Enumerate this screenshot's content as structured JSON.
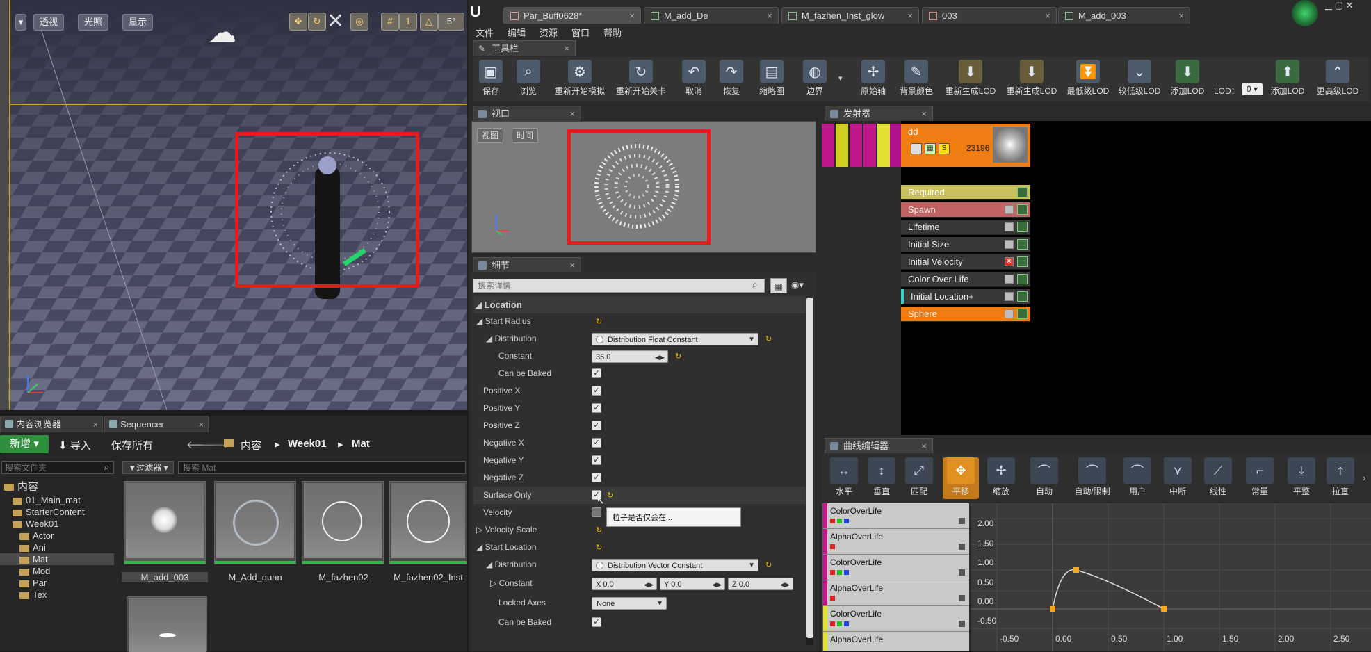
{
  "left_viewport": {
    "buttons": [
      "透视",
      "光照",
      "显示"
    ],
    "grid_snap": "5°"
  },
  "content_browser": {
    "tabs": [
      "内容浏览器",
      "Sequencer"
    ],
    "new_button": "新增",
    "import_button": "导入",
    "save_all_button": "保存所有",
    "breadcrumb": [
      "内容",
      "Week01",
      "Mat"
    ],
    "folder_search_placeholder": "搜索文件夹",
    "filter_button": "过滤器",
    "asset_search_placeholder": "搜索 Mat",
    "folders": [
      "内容",
      "01_Main_mat",
      "StarterContent",
      "Week01",
      "Actor",
      "Ani",
      "Mat",
      "Mod",
      "Par",
      "Tex"
    ],
    "assets": [
      "M_add_003",
      "M_Add_quan",
      "M_fazhen02",
      "M_fazhen02_Inst"
    ]
  },
  "editor": {
    "doc_tabs": [
      "Par_Buff0628*",
      "M_add_De",
      "M_fazhen_Inst_glow",
      "003",
      "M_add_003"
    ],
    "menu": [
      "文件",
      "编辑",
      "资源",
      "窗口",
      "帮助"
    ],
    "toolbar_tab": "工具栏",
    "toolbar": [
      {
        "label": "保存",
        "icon": "save-icon"
      },
      {
        "label": "浏览",
        "icon": "browse-icon"
      },
      {
        "label": "重新开始模拟",
        "icon": "restart-sim-icon"
      },
      {
        "label": "重新开始关卡",
        "icon": "restart-level-icon"
      },
      {
        "label": "取消",
        "icon": "undo-icon"
      },
      {
        "label": "恢复",
        "icon": "redo-icon"
      },
      {
        "label": "缩略图",
        "icon": "thumbnail-icon"
      },
      {
        "label": "边界",
        "icon": "bounds-icon"
      },
      {
        "label": "原始轴",
        "icon": "origin-axis-icon"
      },
      {
        "label": "背景颜色",
        "icon": "bg-color-icon"
      },
      {
        "label": "重新生成LOD",
        "icon": "regen-lod-icon"
      },
      {
        "label": "重新生成LOD",
        "icon": "regen-lod-icon"
      },
      {
        "label": "最低级LOD",
        "icon": "lowest-lod-icon"
      },
      {
        "label": "较低级LOD",
        "icon": "lower-lod-icon"
      },
      {
        "label": "添加LOD",
        "icon": "add-lod-icon"
      },
      {
        "label": "添加LOD",
        "icon": "add-lod-icon"
      },
      {
        "label": "更高级LOD",
        "icon": "higher-lod-icon"
      }
    ],
    "lod_label": "LOD：",
    "lod_value": "0",
    "viewport_tab": "视口",
    "viewport_buttons": [
      "视图",
      "时间"
    ],
    "details_tab": "细节",
    "details_search_placeholder": "搜索详情",
    "emitter_tab": "发射器",
    "emitter": {
      "name": "dd",
      "count": "23196",
      "s_label": "S"
    },
    "modules": [
      "Required",
      "Spawn",
      "Lifetime",
      "Initial Size",
      "Initial Velocity",
      "Color Over Life",
      "Initial Location+",
      "Sphere"
    ],
    "curve_editor_tab": "曲线编辑器",
    "curve_tools": [
      "水平",
      "垂直",
      "匹配",
      "平移",
      "缩放",
      "自动",
      "自动/限制",
      "用户",
      "中断",
      "线性",
      "常量",
      "平整",
      "拉直"
    ],
    "curve_items": [
      "ColorOverLife",
      "AlphaOverLife",
      "ColorOverLife",
      "AlphaOverLife",
      "ColorOverLife",
      "AlphaOverLife"
    ],
    "y_ticks": [
      "2.00",
      "1.50",
      "1.00",
      "0.50",
      "0.00",
      "-0.50"
    ],
    "x_ticks": [
      "-0.50",
      "0.00",
      "0.50",
      "1.00",
      "1.50",
      "2.00",
      "2.50"
    ]
  },
  "details": {
    "section": "Location",
    "start_radius": "Start Radius",
    "distribution": "Distribution",
    "dist_float_value": "Distribution Float Constant",
    "constant": "Constant",
    "constant_value": "35.0",
    "can_be_baked": "Can be Baked",
    "positive_x": "Positive X",
    "positive_y": "Positive Y",
    "positive_z": "Positive Z",
    "negative_x": "Negative X",
    "negative_y": "Negative Y",
    "negative_z": "Negative Z",
    "surface_only": "Surface Only",
    "velocity": "Velocity",
    "velocity_scale": "Velocity Scale",
    "start_location": "Start Location",
    "distribution2": "Distribution",
    "dist_vector_value": "Distribution Vector Constant",
    "constant2": "Constant",
    "x_val": "X 0.0",
    "y_val": "Y 0.0",
    "z_val": "Z 0.0",
    "locked_axes": "Locked Axes",
    "locked_axes_value": "None",
    "can_be_baked2": "Can be Baked",
    "tooltip": "粒子是否仅会在..."
  }
}
